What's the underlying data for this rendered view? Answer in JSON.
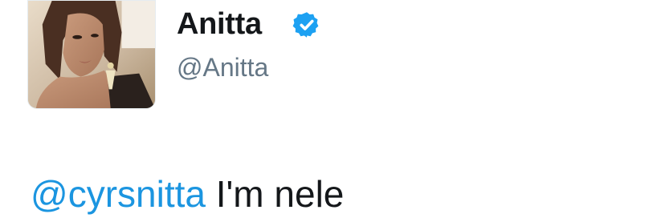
{
  "author": {
    "display_name": "Anitta",
    "handle": "@Anitta",
    "verified": true,
    "avatar_icon": "profile-photo"
  },
  "tweet": {
    "mention": "@cyrsnitta",
    "text": " I'm nele"
  },
  "colors": {
    "mention": "#1b95e0",
    "verified_badge": "#1da1f2",
    "handle": "#657786",
    "text": "#14171a"
  }
}
